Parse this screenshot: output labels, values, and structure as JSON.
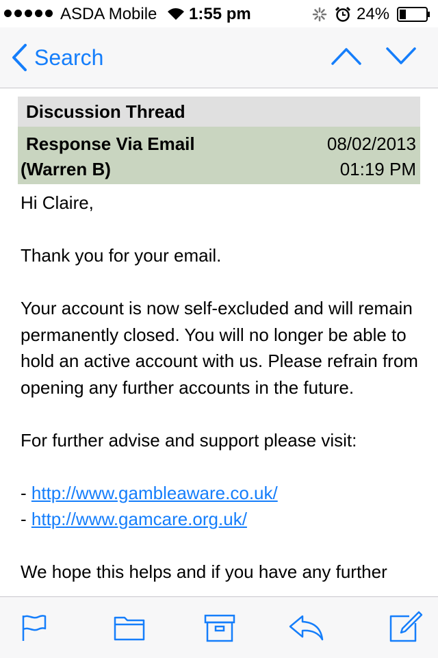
{
  "status_bar": {
    "carrier": "ASDA Mobile",
    "time": "1:55 pm",
    "battery": "24%"
  },
  "nav": {
    "back_label": "Search"
  },
  "thread": {
    "header": "Discussion Thread",
    "response_title": "Response Via Email",
    "response_author": "(Warren B)",
    "response_date": "08/02/2013",
    "response_time": "01:19 PM"
  },
  "message": {
    "greeting": "Hi Claire,",
    "p1": "Thank you for your email.",
    "p2": "Your account is now self-excluded and will remain permanently closed. You will no longer be able to hold an active account with us. Please refrain from opening any further accounts in the future.",
    "p3": "For further advise and support please visit:",
    "dash": "- ",
    "link1": "http://www.gambleaware.co.uk/",
    "link2": "http://www.gamcare.org.uk/",
    "p4": "We hope this helps and if you have any further"
  },
  "colors": {
    "accent": "#157efb",
    "thread_header_bg": "#e0e0e0",
    "response_bg": "#c9d5c0"
  },
  "icons": {
    "toolbar": [
      "flag-icon",
      "folder-icon",
      "archive-icon",
      "reply-icon",
      "compose-icon"
    ]
  }
}
